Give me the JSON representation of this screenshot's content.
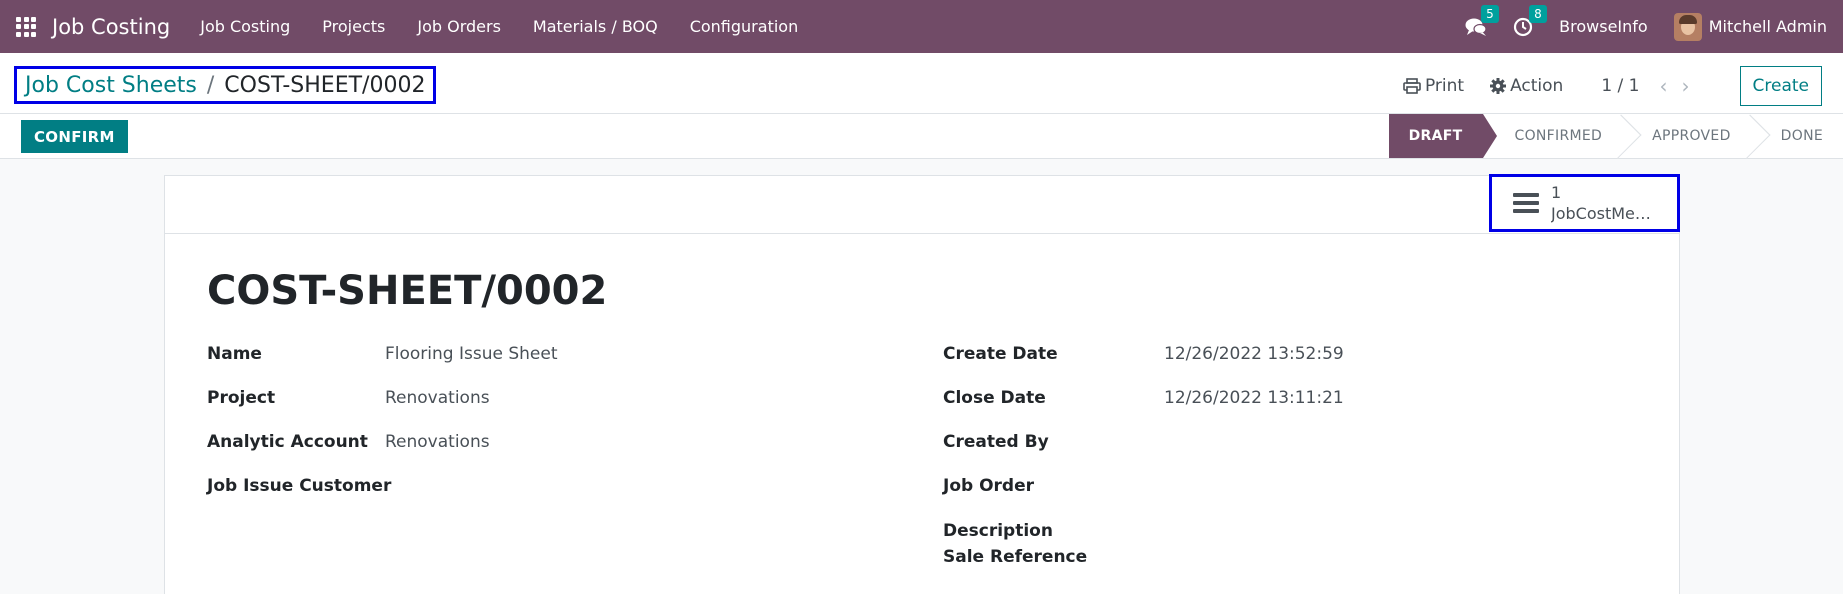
{
  "navbar": {
    "app_name": "Job Costing",
    "menu": [
      "Job Costing",
      "Projects",
      "Job Orders",
      "Materials / BOQ",
      "Configuration"
    ],
    "messages_count": "5",
    "activities_count": "8",
    "company": "BrowseInfo",
    "user": "Mitchell Admin",
    "color": "#714b67"
  },
  "breadcrumb": {
    "parent": "Job Cost Sheets",
    "separator": "/",
    "current": "COST-SHEET/0002"
  },
  "control_panel": {
    "print_label": "Print",
    "action_label": "Action",
    "pager": "1 / 1",
    "create_label": "Create"
  },
  "toolbar": {
    "confirm_label": "CONFIRM"
  },
  "statusbar": {
    "stages": [
      "DRAFT",
      "CONFIRMED",
      "APPROVED",
      "DONE"
    ],
    "active": "DRAFT"
  },
  "smart_button": {
    "count": "1",
    "label": "JobCostMe…",
    "icon": "list-icon"
  },
  "form": {
    "title": "COST-SHEET/0002",
    "left_fields": [
      {
        "label": "Name",
        "value": "Flooring Issue Sheet"
      },
      {
        "label": "Project",
        "value": "Renovations"
      },
      {
        "label": "Analytic Account",
        "value": "Renovations"
      },
      {
        "label": "Job Issue Customer",
        "value": ""
      }
    ],
    "right_fields": [
      {
        "label": "Create Date",
        "value": "12/26/2022 13:52:59"
      },
      {
        "label": "Close Date",
        "value": "12/26/2022 13:11:21"
      },
      {
        "label": "Created By",
        "value": ""
      },
      {
        "label": "Job Order",
        "value": ""
      },
      {
        "label": "Description Sale Reference",
        "value": ""
      }
    ]
  }
}
